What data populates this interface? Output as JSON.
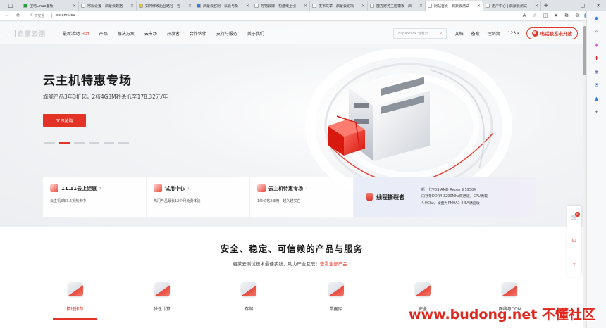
{
  "browser": {
    "tabs": [
      {
        "title": "宝塔Linux面板",
        "color": "#20a53a"
      },
      {
        "title": "常规设置 - 启蒙云数据",
        "color": "#ffffff"
      },
      {
        "title": "如何修改后台路径 - 哲",
        "color": "#f5c518"
      },
      {
        "title": "启蒙云官网 - 以云与新",
        "color": "#2f7be8"
      },
      {
        "title": "万物云媒 - 构建线上引",
        "color": "#ffffff"
      },
      {
        "title": "发布文章 - 启蒙云论坛",
        "color": "#ffffff"
      },
      {
        "title": "魔方财务主题模板 - 启",
        "color": "#ffffff"
      },
      {
        "title": "网站首页 - 启蒙云测试",
        "color": "#ffffff",
        "active": true
      },
      {
        "title": "用户中心 | 启蒙云测试",
        "color": "#ffffff"
      }
    ],
    "new_tab": "+",
    "address": {
      "warning": "不安全",
      "url": "idc.qmy.icu"
    }
  },
  "nav": {
    "logo_text": "启蒙云测",
    "items": [
      {
        "label": "最新活动",
        "hot": "HOT"
      },
      {
        "label": "产品"
      },
      {
        "label": "解决方案"
      },
      {
        "label": "云市场"
      },
      {
        "label": "开发者"
      },
      {
        "label": "合作伙伴"
      },
      {
        "label": "支持与服务"
      },
      {
        "label": "关于我们"
      }
    ],
    "search_placeholder": "LolipaStack 专有云",
    "links": [
      "文档",
      "备案",
      "控制台",
      "123"
    ],
    "hotline": "电话联系未开放"
  },
  "hero": {
    "title": "云主机特惠专场",
    "subtitle": "旗舰产品3年3折起，2核4G3M秒杀低至178.32元/年",
    "cta": "立即抢购",
    "slide_count": 6,
    "active_slide": 1
  },
  "promos": [
    {
      "title": "11.11云上钜惠",
      "desc": "云主机3年3.5折热卖中"
    },
    {
      "title": "试用中心",
      "desc": "热门产品最长12个月免费体验"
    },
    {
      "title": "云主机特惠专场",
      "desc": "1年价格3年用，越久越实在"
    }
  ],
  "promo_big": {
    "title": "线程撕裂者",
    "lines": [
      "新一代VDS AMD Ryzen 9 5950X",
      "内存条DDR4 3200Mhz双通道，CPU满载",
      "4.9Ghz，硬盘为PM9A1 2.5A满血版"
    ]
  },
  "section": {
    "title": "安全、稳定、可信赖的产品与服务",
    "subtitle": "启蒙云测试技术最佳实践，助力产业互联！",
    "link": "查看全部产品",
    "link_arrow": "›",
    "categories": [
      {
        "label": "精选推荐",
        "active": true
      },
      {
        "label": "弹性计算"
      },
      {
        "label": "存储"
      },
      {
        "label": "数据库"
      },
      {
        "label": "安全"
      },
      {
        "label": "网络与CDN"
      }
    ]
  },
  "float": {
    "cart_badge": "0"
  },
  "watermark": "www.budong.net 不懂社区"
}
